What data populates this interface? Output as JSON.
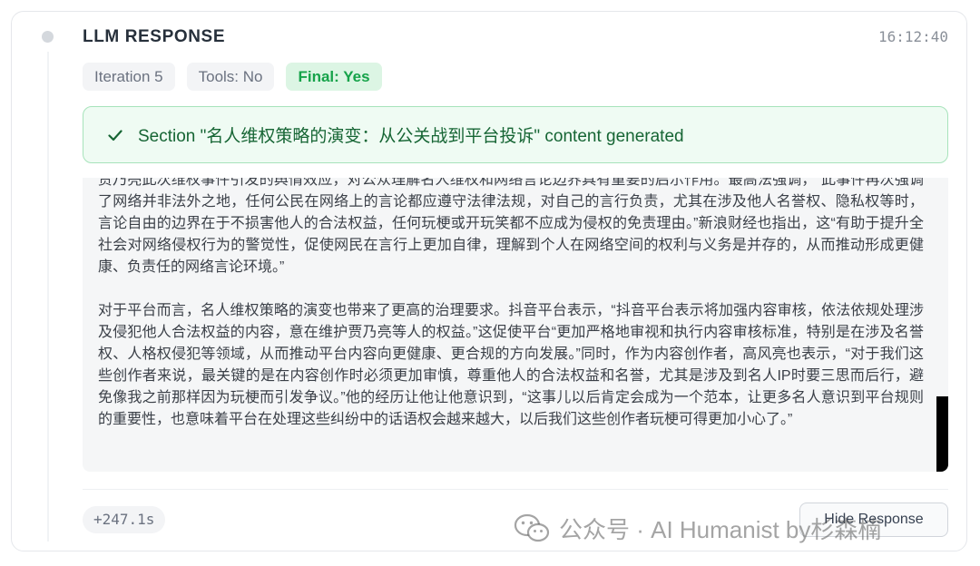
{
  "header": {
    "title": "LLM RESPONSE",
    "timestamp": "16:12:40"
  },
  "tags": [
    {
      "label": "Iteration 5",
      "status": "neutral"
    },
    {
      "label": "Tools: No",
      "status": "neutral"
    },
    {
      "label": "Final: Yes",
      "status": "success"
    }
  ],
  "banner": {
    "icon": "check-icon",
    "text": "Section \"名人维权策略的演变：从公关战到平台投诉\" content generated"
  },
  "response": {
    "paragraphs": [
      "贾乃亮此次维权事件引发的舆情效应，对公众理解名人维权和网络言论边界具有重要的启示作用。最高法强调，“此事件再次强调了网络并非法外之地，任何公民在网络上的言论都应遵守法律法规，对自己的言行负责，尤其在涉及他人名誉权、隐私权等时，言论自由的边界在于不损害他人的合法权益，任何玩梗或开玩笑都不应成为侵权的免责理由。”新浪财经也指出，这“有助于提升全社会对网络侵权行为的警觉性，促使网民在言行上更加自律，理解到个人在网络空间的权利与义务是并存的，从而推动形成更健康、负责任的网络言论环境。”",
      "对于平台而言，名人维权策略的演变也带来了更高的治理要求。抖音平台表示，“抖音平台表示将加强内容审核，依法依规处理涉及侵犯他人合法权益的内容，意在维护贾乃亮等人的权益。”这促使平台“更加严格地审视和执行内容审核标准，特别是在涉及名誉权、人格权侵犯等领域，从而推动平台内容向更健康、更合规的方向发展。”同时，作为内容创作者，高风亮也表示，“对于我们这些创作者来说，最关键的是在内容创作时必须更加审慎，尊重他人的合法权益和名誉，尤其是涉及到名人IP时要三思而后行，避免像我之前那样因为玩梗而引发争议。”他的经历让他让他意识到，“这事儿以后肯定会成为一个范本，让更多名人意识到平台规则的重要性，也意味着平台在处理这些纠纷中的话语权会越来越大，以后我们这些创作者玩梗可得更加小心了。”"
    ]
  },
  "footer": {
    "duration": "+247.1s",
    "hide_button_label": "Hide Response"
  },
  "watermark": {
    "text": "公众号 · AI Humanist by杉森楠"
  },
  "colors": {
    "success_text": "#16a34a",
    "success_bg": "#dcf5e4",
    "banner_border": "#a7e3bb"
  }
}
